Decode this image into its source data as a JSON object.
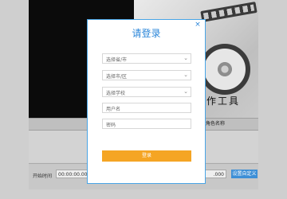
{
  "modal": {
    "title": "请登录",
    "close_icon": "×",
    "province_select": {
      "placeholder": "选择省/市",
      "icon": "chevron-down-icon"
    },
    "city_select": {
      "placeholder": "选择市/区",
      "icon": "chevron-down-icon"
    },
    "school_select": {
      "placeholder": "选择学校",
      "icon": "chevron-down-icon"
    },
    "username_field": {
      "placeholder": "用户名"
    },
    "password_field": {
      "placeholder": "密码"
    },
    "login_button": "登录",
    "colors": {
      "accent_blue": "#2a86d9",
      "button_orange": "#f5a524"
    }
  },
  "background": {
    "banner_text": "作工具",
    "table_header_right": "角色名称",
    "start_time_label": "开始时间",
    "start_time_value": "00:00:00.000",
    "end_time_value": ".000",
    "import_button": "设置自定义"
  }
}
